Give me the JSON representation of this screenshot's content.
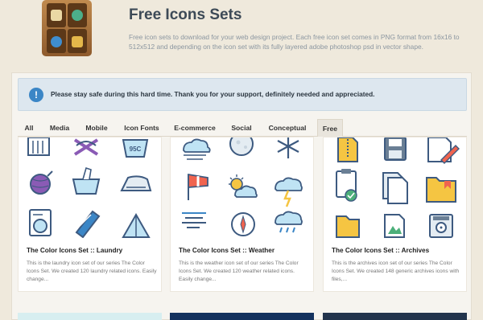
{
  "header": {
    "title": "Free Icons Sets",
    "description": "Free icon sets to download for your web design project. Each free icon set comes in PNG format from 16x16 to 512x512 and depending on the icon set with its fully layered adobe photoshop psd in vector shape."
  },
  "alert": {
    "icon": "info-icon",
    "text": "Please stay safe during this hard time. Thank you for your support, definitely needed and appreciated."
  },
  "tabs": [
    {
      "label": "All"
    },
    {
      "label": "Media"
    },
    {
      "label": "Mobile"
    },
    {
      "label": "Icon Fonts"
    },
    {
      "label": "E-commerce"
    },
    {
      "label": "Social"
    },
    {
      "label": "Conceptual"
    },
    {
      "label": "Free"
    }
  ],
  "active_tab": "Free",
  "cards": [
    {
      "title": "The Color Icons Set :: Laundry",
      "text": "This is the laundry icon set of our series The Color Icons Set. We created 120 laundry related icons. Easily change...",
      "icons": [
        "laundry-icons",
        "washing-symbol-icon",
        "wool-icon",
        "hand-wash-icon",
        "iron-icon",
        "washing-machine-icon"
      ],
      "badge_text": "95C"
    },
    {
      "title": "The Color Icons Set :: Weather",
      "text": "This is the weather icon set of our series The Color Icons Set. We created 120 weather related icons. Easily change...",
      "icons": [
        "wind-cloud-icon",
        "moon-icon",
        "snowflake-icon",
        "windsock-icon",
        "sun-cloud-icon",
        "thunderstorm-icon",
        "fog-icon",
        "compass-icon",
        "rain-cloud-icon"
      ]
    },
    {
      "title": "The Color Icons Set :: Archives",
      "text": "This is the archives icon set of our series The Color Icons Set. We created 148 generic archives icons with files,...",
      "icons": [
        "zipper-file-icon",
        "floppy-disk-icon",
        "edit-document-icon",
        "clipboard-check-icon",
        "copy-files-icon",
        "folder-icon",
        "open-folder-icon",
        "image-file-icon",
        "disk-icon"
      ]
    }
  ],
  "colors": {
    "background": "#efe9dc",
    "alert_bg": "#dde7ef",
    "info_blue": "#3b86c6",
    "title_color": "#3d4a57",
    "bottom_card_1": "#d7eef0",
    "bottom_card_2": "#14325e",
    "bottom_card_3": "#22344c"
  }
}
